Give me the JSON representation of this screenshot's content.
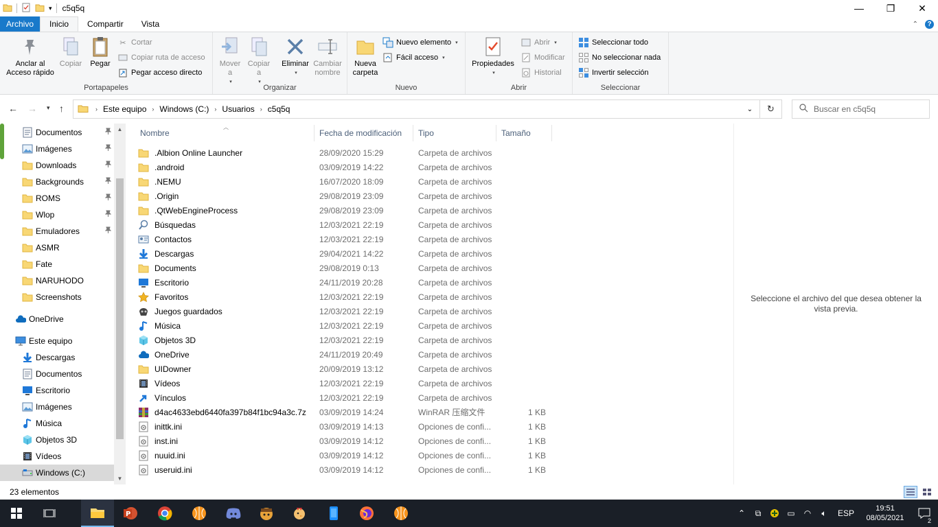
{
  "window": {
    "title": "c5q5q",
    "minimize_glyph": "—",
    "maximize_glyph": "❐",
    "close_glyph": "✕"
  },
  "tabs": [
    {
      "label": "Archivo"
    },
    {
      "label": "Inicio"
    },
    {
      "label": "Compartir"
    },
    {
      "label": "Vista"
    }
  ],
  "ribbon": {
    "clipboard": {
      "label": "Portapapeles",
      "pin": "Anclar al\nAcceso rápido",
      "copy": "Copiar",
      "paste": "Pegar",
      "cut": "Cortar",
      "copy_path": "Copiar ruta de acceso",
      "paste_shortcut": "Pegar acceso directo"
    },
    "organize": {
      "label": "Organizar",
      "move": "Mover\na",
      "copy_to": "Copiar\na",
      "delete": "Eliminar",
      "rename": "Cambiar\nnombre"
    },
    "new": {
      "label": "Nuevo",
      "new_folder": "Nueva\ncarpeta",
      "new_item": "Nuevo elemento",
      "easy_access": "Fácil acceso"
    },
    "open": {
      "label": "Abrir",
      "properties": "Propiedades",
      "open": "Abrir",
      "edit": "Modificar",
      "history": "Historial"
    },
    "select": {
      "label": "Seleccionar",
      "select_all": "Seleccionar todo",
      "select_none": "No seleccionar nada",
      "invert": "Invertir selección"
    }
  },
  "address": {
    "crumbs": [
      "Este equipo",
      "Windows (C:)",
      "Usuarios",
      "c5q5q"
    ],
    "search_placeholder": "Buscar en c5q5q"
  },
  "nav": {
    "quick": [
      {
        "label": "Documentos",
        "icon": "documents-icon",
        "pinned": true
      },
      {
        "label": "Imágenes",
        "icon": "pictures-icon",
        "pinned": true
      },
      {
        "label": "Downloads",
        "icon": "folder-icon",
        "pinned": true
      },
      {
        "label": "Backgrounds",
        "icon": "folder-icon",
        "pinned": true
      },
      {
        "label": "ROMS",
        "icon": "folder-icon",
        "pinned": true
      },
      {
        "label": "Wlop",
        "icon": "folder-icon",
        "pinned": true
      },
      {
        "label": "Emuladores",
        "icon": "folder-icon",
        "pinned": true
      },
      {
        "label": "ASMR",
        "icon": "folder-icon",
        "pinned": false
      },
      {
        "label": "Fate",
        "icon": "folder-icon",
        "pinned": false
      },
      {
        "label": "NARUHODO",
        "icon": "folder-icon",
        "pinned": false
      },
      {
        "label": "Screenshots",
        "icon": "folder-icon",
        "pinned": false
      }
    ],
    "onedrive": "OneDrive",
    "this_pc": "Este equipo",
    "pc_items": [
      {
        "label": "Descargas",
        "icon": "download-icon"
      },
      {
        "label": "Documentos",
        "icon": "documents-icon"
      },
      {
        "label": "Escritorio",
        "icon": "desktop-icon"
      },
      {
        "label": "Imágenes",
        "icon": "pictures-icon"
      },
      {
        "label": "Música",
        "icon": "music-icon"
      },
      {
        "label": "Objetos 3D",
        "icon": "3d-objects-icon"
      },
      {
        "label": "Vídeos",
        "icon": "videos-icon"
      },
      {
        "label": "Windows (C:)",
        "icon": "drive-icon"
      }
    ]
  },
  "columns": {
    "name": "Nombre",
    "date": "Fecha de modificación",
    "type": "Tipo",
    "size": "Tamaño"
  },
  "files": [
    {
      "name": ".Albion Online Launcher",
      "date": "28/09/2020 15:29",
      "type": "Carpeta de archivos",
      "size": "",
      "icon": "folder"
    },
    {
      "name": ".android",
      "date": "03/09/2019 14:22",
      "type": "Carpeta de archivos",
      "size": "",
      "icon": "folder"
    },
    {
      "name": ".NEMU",
      "date": "16/07/2020 18:09",
      "type": "Carpeta de archivos",
      "size": "",
      "icon": "folder"
    },
    {
      "name": ".Origin",
      "date": "29/08/2019 23:09",
      "type": "Carpeta de archivos",
      "size": "",
      "icon": "folder"
    },
    {
      "name": ".QtWebEngineProcess",
      "date": "29/08/2019 23:09",
      "type": "Carpeta de archivos",
      "size": "",
      "icon": "folder"
    },
    {
      "name": "Búsquedas",
      "date": "12/03/2021 22:19",
      "type": "Carpeta de archivos",
      "size": "",
      "icon": "search"
    },
    {
      "name": "Contactos",
      "date": "12/03/2021 22:19",
      "type": "Carpeta de archivos",
      "size": "",
      "icon": "contacts"
    },
    {
      "name": "Descargas",
      "date": "29/04/2021 14:22",
      "type": "Carpeta de archivos",
      "size": "",
      "icon": "download"
    },
    {
      "name": "Documents",
      "date": "29/08/2019 0:13",
      "type": "Carpeta de archivos",
      "size": "",
      "icon": "folder"
    },
    {
      "name": "Escritorio",
      "date": "24/11/2019 20:28",
      "type": "Carpeta de archivos",
      "size": "",
      "icon": "desktop"
    },
    {
      "name": "Favoritos",
      "date": "12/03/2021 22:19",
      "type": "Carpeta de archivos",
      "size": "",
      "icon": "star"
    },
    {
      "name": "Juegos guardados",
      "date": "12/03/2021 22:19",
      "type": "Carpeta de archivos",
      "size": "",
      "icon": "games"
    },
    {
      "name": "Música",
      "date": "12/03/2021 22:19",
      "type": "Carpeta de archivos",
      "size": "",
      "icon": "music"
    },
    {
      "name": "Objetos 3D",
      "date": "12/03/2021 22:19",
      "type": "Carpeta de archivos",
      "size": "",
      "icon": "3d"
    },
    {
      "name": "OneDrive",
      "date": "24/11/2019 20:49",
      "type": "Carpeta de archivos",
      "size": "",
      "icon": "cloud"
    },
    {
      "name": "UIDowner",
      "date": "20/09/2019 13:12",
      "type": "Carpeta de archivos",
      "size": "",
      "icon": "folder"
    },
    {
      "name": "Vídeos",
      "date": "12/03/2021 22:19",
      "type": "Carpeta de archivos",
      "size": "",
      "icon": "videos"
    },
    {
      "name": "Vínculos",
      "date": "12/03/2021 22:19",
      "type": "Carpeta de archivos",
      "size": "",
      "icon": "link"
    },
    {
      "name": "d4ac4633ebd6440fa397b84f1bc94a3c.7z",
      "date": "03/09/2019 14:24",
      "type": "WinRAR 压缩文件",
      "size": "1 KB",
      "icon": "rar"
    },
    {
      "name": "inittk.ini",
      "date": "03/09/2019 14:13",
      "type": "Opciones de confi...",
      "size": "1 KB",
      "icon": "ini"
    },
    {
      "name": "inst.ini",
      "date": "03/09/2019 14:12",
      "type": "Opciones de confi...",
      "size": "1 KB",
      "icon": "ini"
    },
    {
      "name": "nuuid.ini",
      "date": "03/09/2019 14:12",
      "type": "Opciones de confi...",
      "size": "1 KB",
      "icon": "ini"
    },
    {
      "name": "useruid.ini",
      "date": "03/09/2019 14:12",
      "type": "Opciones de confi...",
      "size": "1 KB",
      "icon": "ini"
    }
  ],
  "preview": {
    "message": "Seleccione el archivo del que desea obtener la vista previa."
  },
  "status": {
    "count": "23 elementos"
  },
  "taskbar": {
    "lang": "ESP",
    "time": "19:51",
    "date": "08/05/2021",
    "notifications": "2"
  },
  "colors": {
    "file_tab": "#1979ca",
    "folder": "#f8d775",
    "taskbar": "#1a1f27"
  }
}
